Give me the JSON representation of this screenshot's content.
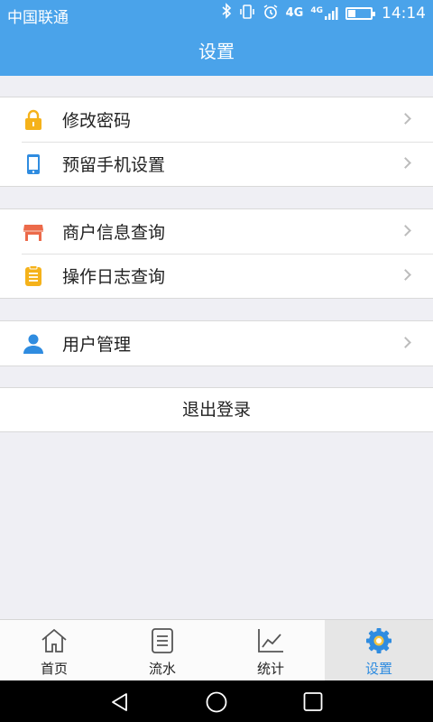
{
  "status_bar": {
    "carrier": "中国联通",
    "network_a": "4G",
    "network_b": "4G",
    "time": "14:14",
    "battery_level": 0.35,
    "icons": [
      "bluetooth-icon",
      "vibrate-icon",
      "alarm-icon",
      "signal-icon",
      "battery-icon"
    ]
  },
  "header": {
    "title": "设置"
  },
  "settings": {
    "group1": [
      {
        "label": "修改密码",
        "icon": "lock-icon",
        "color": "#f5b21a"
      },
      {
        "label": "预留手机设置",
        "icon": "phone-icon",
        "color": "#2f8ce0"
      }
    ],
    "group2": [
      {
        "label": "商户信息查询",
        "icon": "shop-icon",
        "color": "#ec6a4a"
      },
      {
        "label": "操作日志查询",
        "icon": "log-icon",
        "color": "#f5b21a"
      }
    ],
    "group3": [
      {
        "label": "用户管理",
        "icon": "user-icon",
        "color": "#2f8ce0"
      }
    ]
  },
  "logout": {
    "label": "退出登录"
  },
  "tab_bar": {
    "tabs": [
      {
        "label": "首页",
        "icon": "home-icon"
      },
      {
        "label": "流水",
        "icon": "list-icon"
      },
      {
        "label": "统计",
        "icon": "chart-icon"
      },
      {
        "label": "设置",
        "icon": "gear-icon",
        "active": true
      }
    ]
  },
  "colors": {
    "primary": "#4aa3ea",
    "active_tab": "#2f8ce0",
    "background": "#efeff4"
  }
}
